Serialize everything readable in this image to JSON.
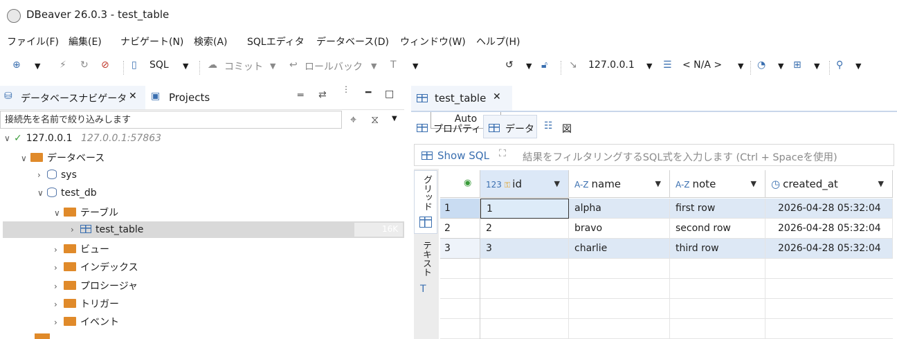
{
  "window": {
    "title": "DBeaver 26.0.3 - test_table"
  },
  "menu": [
    "ファイル(F)",
    "編集(E)",
    "ナビゲート(N)",
    "検索(A)",
    "SQLエディタ",
    "データベース(D)",
    "ウィンドウ(W)",
    "ヘルプ(H)"
  ],
  "toolbar": {
    "sql_label": "SQL",
    "commit_label": "コミット",
    "rollback_label": "ロールバック",
    "tx_mode": "Auto",
    "connection": "127.0.0.1",
    "schema": "< N/A >"
  },
  "left_panel": {
    "tab_navigator": "データベースナビゲータ",
    "tab_projects": "Projects",
    "filter_placeholder": "接続先を名前で絞り込みします",
    "tree": {
      "connection": "127.0.0.1",
      "connection_detail": "127.0.0.1:57863",
      "databases": "データベース",
      "db1": "sys",
      "db2": "test_db",
      "tables": "テーブル",
      "table1": "test_table",
      "table1_size": "16K",
      "views": "ビュー",
      "indexes": "インデックス",
      "procedures": "プロシージャ",
      "triggers": "トリガー",
      "events": "イベント"
    }
  },
  "editor": {
    "tab_label": "test_table",
    "subtabs": [
      "プロパティ",
      "データ",
      "図"
    ],
    "show_sql": "Show SQL",
    "filter_placeholder": "結果をフィルタリングするSQL式を入力します (Ctrl + Spaceを使用)",
    "side_tabs": [
      "グリッド",
      "テキスト"
    ],
    "columns": [
      {
        "type": "123",
        "name": "id"
      },
      {
        "type": "A-Z",
        "name": "name"
      },
      {
        "type": "A-Z",
        "name": "note"
      },
      {
        "type": "clock",
        "name": "created_at"
      }
    ],
    "rows": [
      {
        "num": "1",
        "id": "1",
        "name": "alpha",
        "note": "first row",
        "created_at": "2026-04-28 05:32:04"
      },
      {
        "num": "2",
        "id": "2",
        "name": "bravo",
        "note": "second row",
        "created_at": "2026-04-28 05:32:04"
      },
      {
        "num": "3",
        "id": "3",
        "name": "charlie",
        "note": "third row",
        "created_at": "2026-04-28 05:32:04"
      }
    ]
  },
  "colors": {
    "accent": "#3a6fb0",
    "selected_row": "#dde8f5",
    "folder": "#e08a2a"
  }
}
